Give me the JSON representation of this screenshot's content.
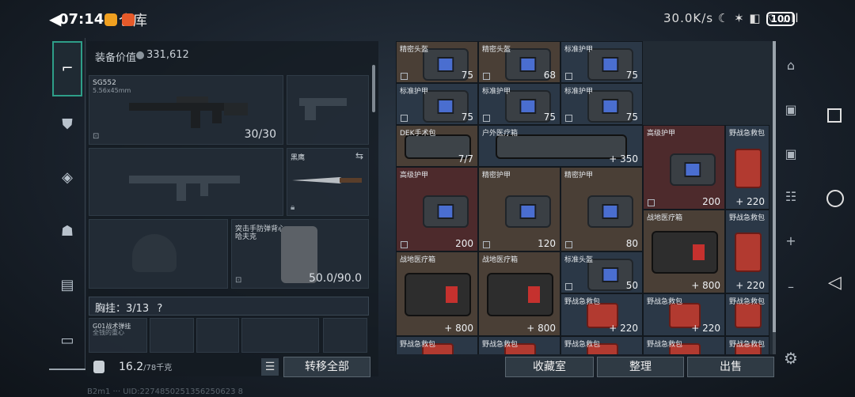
{
  "status_bar": {
    "time": "07:14",
    "title": "仓库",
    "right_text": "30.0K/s ☾ ✶ ◧ ⌔ .ıll"
  },
  "battery": {
    "percent": "100"
  },
  "left_panel": {
    "equipment_value_label": "装备价值",
    "equipment_value": "331,612",
    "primary_weapon": {
      "name": "SG552",
      "caliber": "5.56x45mm",
      "ammo": "30/30"
    },
    "melee": {
      "name": "黑鹰"
    },
    "armor": {
      "name": "突击手防弹背心",
      "subname": "哈夫克",
      "durability": "50.0/90.0"
    },
    "chest_rig": {
      "label": "胸挂：3/13",
      "help": "?",
      "item_name": "G01战术弹挂",
      "item_sub": "全钱的重心"
    },
    "weight_value": "16.2",
    "weight_max": "/78千克",
    "transfer_all_label": "转移全部"
  },
  "inventory": {
    "items": [
      {
        "name": "精密头盔",
        "value": "75",
        "kind": "bag",
        "color": "#4a3f36"
      },
      {
        "name": "精密头盔",
        "value": "68",
        "kind": "bag",
        "color": "#4a3f36"
      },
      {
        "name": "标准护甲",
        "value": "75",
        "kind": "bag",
        "color": "#2b3847"
      },
      {
        "name": "标准护甲",
        "value": "75",
        "kind": "bag",
        "color": "#2b3847"
      },
      {
        "name": "标准护甲",
        "value": "75",
        "kind": "bag",
        "color": "#2b3847"
      },
      {
        "name": "标准护甲",
        "value": "75",
        "kind": "bag",
        "color": "#2b3847"
      },
      {
        "name": "DEK手术包",
        "value": "7/7",
        "kind": "case",
        "color": "#4a3f36"
      },
      {
        "name": "户外医疗箱",
        "value": "+ 350",
        "kind": "case",
        "color": "#2b3847"
      },
      {
        "name": "高级护甲",
        "value": "200",
        "kind": "bag",
        "color": "#4d2a2c"
      },
      {
        "name": "野战急救包",
        "value": "+ 220",
        "kind": "red",
        "color": "#2b3847"
      },
      {
        "name": "高级护甲",
        "value": "200",
        "kind": "bag",
        "color": "#4d2a2c"
      },
      {
        "name": "精密护甲",
        "value": "120",
        "kind": "bag",
        "color": "#4a3f36"
      },
      {
        "name": "精密护甲",
        "value": "80",
        "kind": "bag",
        "color": "#4a3f36"
      },
      {
        "name": "战地医疗箱",
        "value": "+ 800",
        "kind": "medkit",
        "color": "#4a3f36"
      },
      {
        "name": "野战急救包",
        "value": "+ 220",
        "kind": "red",
        "color": "#2b3847"
      },
      {
        "name": "战地医疗箱",
        "value": "+ 800",
        "kind": "medkit",
        "color": "#4a3f36"
      },
      {
        "name": "战地医疗箱",
        "value": "+ 800",
        "kind": "medkit",
        "color": "#4a3f36"
      },
      {
        "name": "标准头盔",
        "value": "50",
        "kind": "bag",
        "color": "#2b3847"
      },
      {
        "name": "野战急救包",
        "value": "+ 220",
        "kind": "red",
        "color": "#2b3847"
      },
      {
        "name": "野战急救包",
        "value": "+ 220",
        "kind": "red",
        "color": "#2b3847"
      },
      {
        "name": "野战急救包",
        "value": "",
        "kind": "red",
        "color": "#2b3847"
      },
      {
        "name": "野战急救包",
        "value": "",
        "kind": "red",
        "color": "#2b3847"
      },
      {
        "name": "野战急救包",
        "value": "",
        "kind": "red",
        "color": "#2b3847"
      },
      {
        "name": "野战急救包",
        "value": "",
        "kind": "red",
        "color": "#2b3847"
      },
      {
        "name": "野战急救包",
        "value": "",
        "kind": "red",
        "color": "#2b3847"
      },
      {
        "name": "野战急救包",
        "value": "",
        "kind": "red",
        "color": "#2b3847"
      }
    ]
  },
  "bottom_buttons": {
    "collection_label": "收藏室",
    "organize_label": "整理",
    "sell_label": "出售"
  },
  "bottom_id": "B2m1 ··· UID:2274850251356250623 8",
  "icons": {
    "sidebar": [
      "pistol-icon",
      "vest-icon",
      "badge-icon",
      "backpack-icon",
      "notes-icon",
      "briefcase-icon"
    ],
    "right_sidebar": [
      "bunker-icon",
      "container-icon",
      "container-add-icon",
      "stack-icon",
      "plus-icon",
      "dash-icon",
      "settings-icon"
    ]
  }
}
